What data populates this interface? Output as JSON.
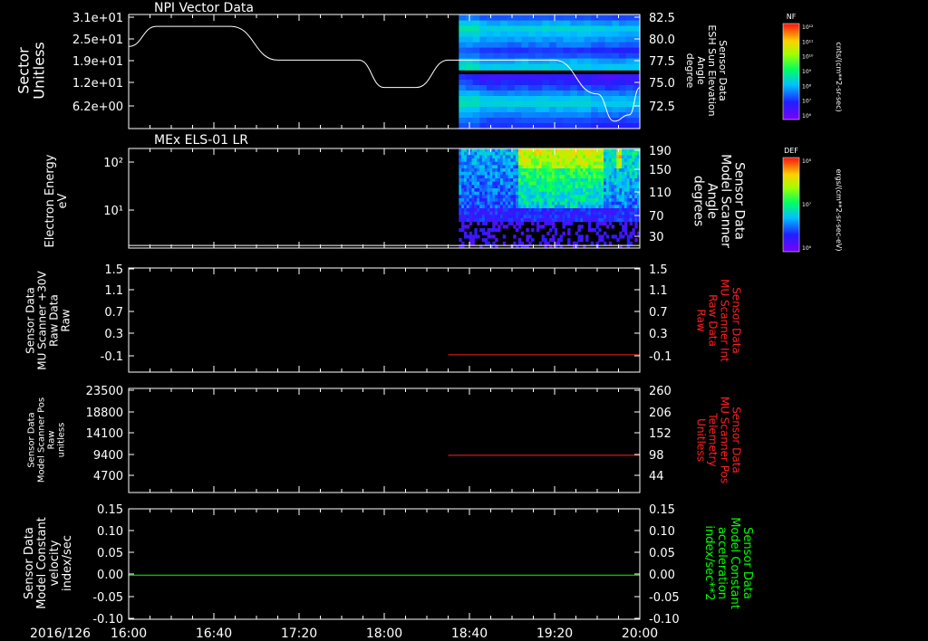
{
  "chart_data": {
    "type": "heatmap",
    "date_label": "2016/126",
    "time_ticks": [
      "16:00",
      "16:40",
      "17:20",
      "18:00",
      "18:40",
      "19:20",
      "20:00"
    ],
    "panels": [
      {
        "id": "npi",
        "title": "NPI Vector Data",
        "type": "heatmap",
        "ylabel_left": [
          "Sector",
          "Unitless"
        ],
        "yticks_left": [
          "3.1e+01",
          "2.5e+01",
          "1.9e+01",
          "1.2e+01",
          "6.2e+00"
        ],
        "ylabel_right": [
          "Sensor Data",
          "ESH Sun Elevation",
          "Angle",
          "degree"
        ],
        "yticks_right": [
          "82.5",
          "80.0",
          "77.5",
          "75.0",
          "72.5"
        ],
        "ylim_right": [
          70.0,
          82.5
        ],
        "data_start": "18:35",
        "colorbar": {
          "label": "NF",
          "unit": "cnts/(cm**2-sr-sec)",
          "ticks": [
            "10¹²",
            "10¹¹",
            "10¹⁰",
            "10⁹",
            "10⁸",
            "10⁷",
            "10⁶"
          ]
        },
        "line_series": {
          "color": "#ffffff",
          "points": [
            [
              "16:00",
              79.0
            ],
            [
              "16:13",
              81.2
            ],
            [
              "16:48",
              81.2
            ],
            [
              "17:10",
              77.5
            ],
            [
              "17:30",
              77.5
            ],
            [
              "17:48",
              77.5
            ],
            [
              "18:00",
              74.5
            ],
            [
              "18:15",
              74.5
            ],
            [
              "18:30",
              77.5
            ],
            [
              "19:20",
              77.5
            ],
            [
              "19:40",
              73.8
            ],
            [
              "19:48",
              70.8
            ],
            [
              "19:55",
              71.5
            ],
            [
              "20:00",
              74.5
            ]
          ]
        }
      },
      {
        "id": "els",
        "title": "MEx ELS-01 LR",
        "type": "heatmap",
        "ylabel_left": [
          "Electron Energy",
          "eV"
        ],
        "yticks_left": [
          "10²",
          "10¹"
        ],
        "ylabel_right": [
          "Sensor Data",
          "Model Scanner",
          "Angle",
          "degrees"
        ],
        "yticks_right": [
          "190",
          "150",
          "110",
          "70",
          "30"
        ],
        "ylim_right": [
          0,
          190
        ],
        "data_start": "18:35",
        "colorbar": {
          "label": "DEF",
          "unit": "ergs/(cm**2-sr-sec-eV)",
          "ticks": [
            "10⁸",
            "10⁷",
            "10⁶"
          ]
        },
        "line_series": {
          "color": "#ffffff",
          "points": [
            [
              "16:00",
              5
            ],
            [
              "20:00",
              5
            ]
          ]
        }
      },
      {
        "id": "mu30",
        "type": "line",
        "ylabel_left": [
          "Sensor Data",
          "MU Scanner +30V",
          "Raw Data",
          "Raw"
        ],
        "yticks_left": [
          "1.5",
          "1.1",
          "0.7",
          "0.3",
          "-0.1"
        ],
        "ylim_left": [
          -0.3,
          1.5
        ],
        "ylabel_right": [
          "Sensor Data",
          "MU Scanner Int",
          "Raw Data",
          "Raw"
        ],
        "ylabel_right_color": "#ff2020",
        "yticks_right": [
          "1.5",
          "1.1",
          "0.7",
          "0.3",
          "-0.1"
        ],
        "series": [
          {
            "color": "#ff2020",
            "points": [
              [
                "18:30",
                0.0
              ],
              [
                "20:00",
                0.0
              ]
            ]
          }
        ]
      },
      {
        "id": "pos",
        "type": "line",
        "ylabel_left": [
          "Sensor Data",
          "Model Scanner Pos",
          "Raw",
          "unitless"
        ],
        "yticks_left": [
          "23500",
          "18800",
          "14100",
          "9400",
          "4700"
        ],
        "ylim_left": [
          0,
          23500
        ],
        "ylabel_right": [
          "Sensor Data",
          "MU Scanner Pos",
          "Telemetry",
          "Unitless"
        ],
        "ylabel_right_color": "#ff2020",
        "yticks_right": [
          "260",
          "206",
          "152",
          "98",
          "44"
        ],
        "series": [
          {
            "color": "#ff2020",
            "points": [
              [
                "18:30",
                8400
              ],
              [
                "20:00",
                8400
              ]
            ]
          }
        ]
      },
      {
        "id": "const",
        "type": "line",
        "ylabel_left": [
          "Sensor Data",
          "Model Constant",
          "velocity",
          "index/sec"
        ],
        "yticks_left": [
          "0.15",
          "0.10",
          "0.05",
          "0.00",
          "-0.05",
          "-0.10"
        ],
        "ylim_left": [
          -0.1,
          0.15
        ],
        "ylabel_right": [
          "Sensor Data",
          "Model Constant",
          "acceleration",
          "index/sec**2"
        ],
        "ylabel_right_color": "#00ff00",
        "yticks_right": [
          "0.15",
          "0.10",
          "0.05",
          "0.00",
          "-0.05",
          "-0.10"
        ],
        "series": [
          {
            "color": "#00ff00",
            "points": [
              [
                "16:00",
                0.0
              ],
              [
                "20:00",
                0.0
              ]
            ]
          }
        ]
      }
    ]
  }
}
